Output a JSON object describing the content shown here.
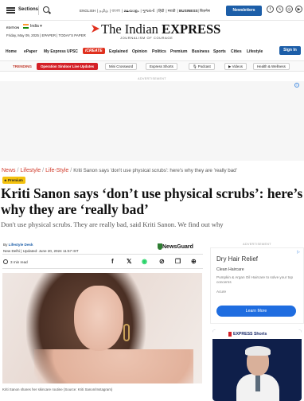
{
  "topbar": {
    "sections_label": "Sections",
    "languages": [
      "ENGLISH",
      "தமிழ்",
      "বাংলা",
      "മലയാളം",
      "ગુજરાતી",
      "हिंदी",
      "मराठी"
    ],
    "business_label": "BUSINESS",
    "extra_lang": "बिज़नेस",
    "newsletter_label": "Newsletters",
    "social_icons": [
      "facebook-icon",
      "x-icon",
      "instagram-icon",
      "youtube-icon"
    ]
  },
  "edition": {
    "label": "EDITION",
    "value": "India",
    "date": "Friday, May 09, 2025",
    "epaper": "EPAPER",
    "todays_paper": "TODAY'S PAPER"
  },
  "logo": {
    "the": "The ",
    "indian": "Indian ",
    "express": "EXPRESS",
    "tagline": "JOURNALISM OF COURAGE"
  },
  "nav": {
    "items": [
      "Home",
      "ePaper",
      "My Express",
      "UPSC",
      "Explained",
      "Opinion",
      "Politics",
      "Premium",
      "Business",
      "Sports",
      "Cities",
      "Lifestyle"
    ],
    "pill": "iCREATE",
    "signin": "Sign In"
  },
  "trending": {
    "label": "TRENDING",
    "chips": [
      "Operation Sindoor Live Updates",
      "Mini Crossword",
      "Express Shorts",
      "Podcast",
      "Videos",
      "Health & Wellness"
    ]
  },
  "ads": {
    "top_label": "ADVERTISEMENT",
    "side_label": "ADVERTISEMENT",
    "side": {
      "title": "Dry Hair Relief",
      "brand": "Clean Haircare",
      "body": "Pumpkin & Argan Oil Haircare to solve your top concerns",
      "sponsor": "Acure",
      "cta": "Learn More"
    }
  },
  "breadcrumb": {
    "news": "News",
    "lifestyle": "Lifestyle",
    "lifestyle2": "Life-Style",
    "current": "Kriti Sanon says 'don't use physical scrubs': here's why they are 'really bad'"
  },
  "article": {
    "badge": "Premium",
    "headline": "Kriti Sanon says ‘don’t use physical scrubs’: here’s why they are ‘really bad’",
    "standfirst": "Don't use physical scrubs. They are really bad, said Kriti Sanon. We find out why",
    "byline_prefix": "By ",
    "author": "Lifestyle Desk",
    "dateline": "New Delhi | Updated: June 20, 2024 11:57 IST",
    "newsguard": "NewsGuard",
    "read_time": "3 min read",
    "caption": "Kriti Sanon shares her skincare routine (Source: Kriti Sanon/Instagram)"
  },
  "shorts": {
    "title": "EXPRESS Shorts"
  }
}
